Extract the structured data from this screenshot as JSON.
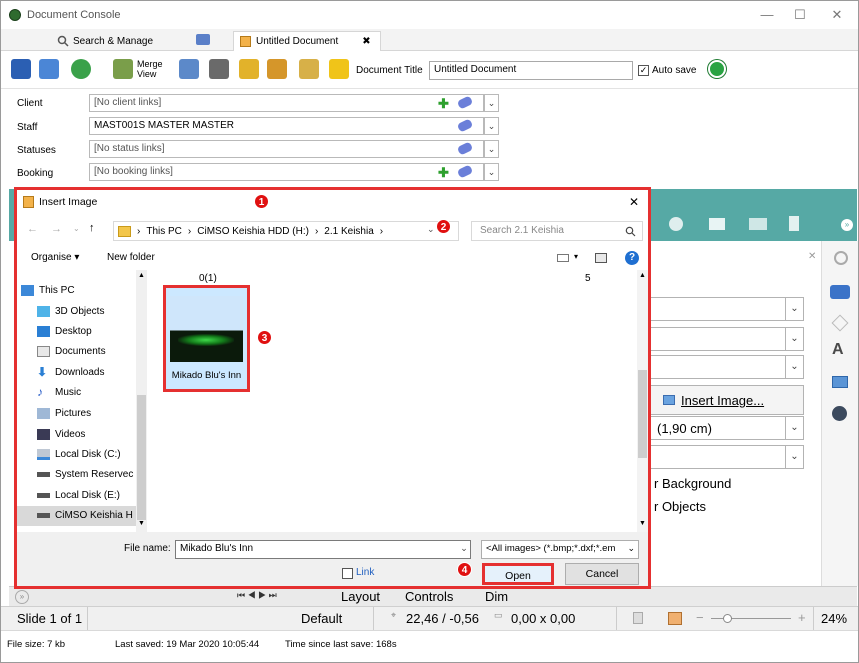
{
  "window": {
    "title": "Document Console",
    "minimize": "—",
    "maximize": "☐",
    "close": "✕"
  },
  "tabs": {
    "search_manage": "Search & Manage",
    "untitled": "Untitled Document",
    "tab_close": "✖"
  },
  "toolbar": {
    "merge_view": "Merge View",
    "doc_title_label": "Document Title",
    "doc_title_value": "Untitled Document",
    "autosave_label": "Auto save",
    "autosave_checked": "✓"
  },
  "fields": [
    {
      "label": "Client",
      "value": "[No client links]"
    },
    {
      "label": "Staff",
      "value": "MAST001S MASTER MASTER"
    },
    {
      "label": "Statuses",
      "value": "[No status links]"
    },
    {
      "label": "Booking",
      "value": "[No booking links]"
    }
  ],
  "dialog": {
    "title": "Insert Image",
    "close": "✕",
    "nav_back": "←",
    "nav_forward": "→",
    "nav_up": "↑",
    "breadcrumb": [
      "This PC",
      "CiMSO Keishia HDD (H:)",
      "2.1 Keishia"
    ],
    "crumb_sep": "›",
    "search_placeholder": "Search 2.1 Keishia",
    "organise": "Organise ▾",
    "new_folder": "New folder",
    "nav_items": [
      "This PC",
      "3D Objects",
      "Desktop",
      "Documents",
      "Downloads",
      "Music",
      "Pictures",
      "Videos",
      "Local Disk (C:)",
      "System Reservec",
      "Local Disk (E:)",
      "CiMSO Keishia H"
    ],
    "group_header": "0(1)",
    "group_count": "5",
    "file_name": "Mikado Blu's Inn",
    "file_name_label": "File name:",
    "file_name_value": "Mikado Blu's Inn",
    "filter": "<All images> (*.bmp;*.dxf;*.em",
    "link_label": "Link",
    "open": "Open",
    "cancel": "Cancel",
    "help": "?"
  },
  "right_panel": {
    "insert_image": "Insert Image...",
    "size_value": "(1,90 cm)",
    "background_text": "r Background",
    "objects_text": "r Objects"
  },
  "bottom_tabs": {
    "layout": "Layout",
    "controls": "Controls",
    "dim": "Dim"
  },
  "status": {
    "slide": "Slide 1 of 1",
    "layout": "Default",
    "coords": "22,46 / -0,56",
    "size": "0,00 x 0,00",
    "zoom": "24%"
  },
  "info": {
    "file_size": "File size: 7 kb",
    "last_saved": "Last saved: 19 Mar 2020 10:05:44",
    "since_save": "Time since last save: 168s"
  },
  "badges": [
    "1",
    "2",
    "3",
    "4"
  ],
  "colors": {
    "highlight": "#e53030",
    "teal": "#56a9a5",
    "tile": "#cce8ff"
  }
}
